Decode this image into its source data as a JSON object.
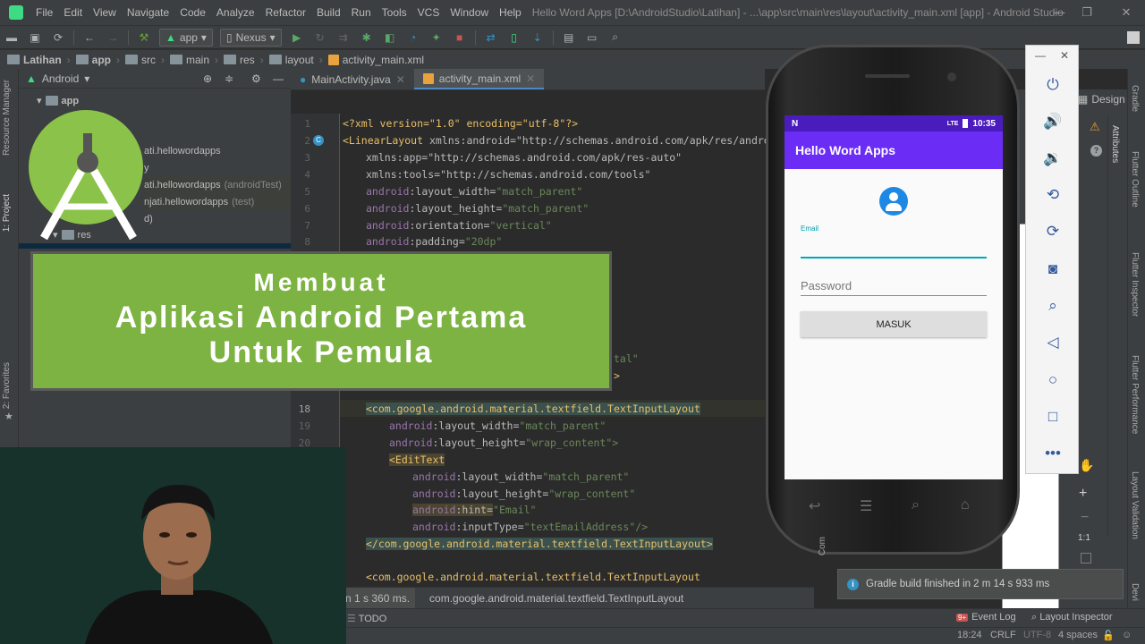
{
  "menu": {
    "items": [
      "File",
      "Edit",
      "View",
      "Navigate",
      "Code",
      "Analyze",
      "Refactor",
      "Build",
      "Run",
      "Tools",
      "VCS",
      "Window",
      "Help"
    ],
    "window_title": "Hello Word Apps [D:\\AndroidStudio\\Latihan] - ...\\app\\src\\main\\res\\layout\\activity_main.xml [app] - Android Studio"
  },
  "toolbar": {
    "run_config": "app",
    "device": "Nexus"
  },
  "breadcrumb": [
    "Latihan",
    "app",
    "src",
    "main",
    "res",
    "layout",
    "activity_main.xml"
  ],
  "left_stripe": {
    "resource_manager": "Resource Manager",
    "project": "1: Project",
    "favorites": "2: Favorites"
  },
  "project_panel": {
    "view_mode": "Android",
    "root": "app",
    "rows": [
      {
        "label": "ati.hellowordapps",
        "suffix": ""
      },
      {
        "label": "y",
        "suffix": ""
      },
      {
        "label": "ati.hellowordapps",
        "suffix": "(androidTest)"
      },
      {
        "label": "njati.hellowordapps",
        "suffix": "(test)"
      },
      {
        "label": "d)",
        "suffix": ""
      },
      {
        "label": "res",
        "suffix": ""
      }
    ]
  },
  "editor_tabs": [
    {
      "label": "MainActivity.java"
    },
    {
      "label": "activity_main.xml"
    }
  ],
  "code": {
    "l1": "<?xml version=\"1.0\" encoding=\"utf-8\"?>",
    "l2_tag": "<LinearLayout ",
    "l2_attr": "xmlns:android=\"http://schemas.android.com/apk/res/android\"",
    "l3": "xmlns:app=\"http://schemas.android.com/apk/res-auto\"",
    "l4": "xmlns:tools=\"http://schemas.android.com/tools\"",
    "l5_a": "android",
    "l5_b": ":layout_width=",
    "l5_c": "\"match_parent\"",
    "l6_b": ":layout_height=",
    "l6_c": "\"match_parent\"",
    "l7_b": ":orientation=",
    "l7_c": "\"vertical\"",
    "l8_b": ":padding=",
    "l8_c": "\"20dp\"",
    "l16_frag": "tal\"",
    "l17_frag": ">",
    "l18": "<com.google.android.material.textfield.TextInputLayout",
    "l19_c": "\"match_parent\"",
    "l20_c": "\"wrap_content\">",
    "l21": "<EditText",
    "l22_c": "\"match_parent\"",
    "l23_c": "\"wrap_content\"",
    "l24_b": ":hint=",
    "l24_c": "\"Email\"",
    "l25_b": ":inputType=",
    "l25_c": "\"textEmailAddress\"/>",
    "l26": "</com.google.android.material.textfield.TextInputLayout>",
    "l28": "<com.google.android.material.textfield.TextInputLayout"
  },
  "line_numbers": [
    "1",
    "2",
    "3",
    "4",
    "5",
    "6",
    "7",
    "8",
    "18",
    "19",
    "20"
  ],
  "editor_footer": {
    "left_frag": "n 1 s 360 ms.",
    "path": "com.google.android.material.textfield.TextInputLayout"
  },
  "bottom_tools": {
    "todo": "TODO",
    "event_log": "Event Log",
    "event_count": "9+",
    "layout_inspector": "Layout Inspector"
  },
  "statusbar": {
    "position": "18:24",
    "line_sep": "CRLF",
    "encoding": "UTF-8",
    "indent": "4 spaces"
  },
  "notification": "Gradle build finished in 2 m 14 s 933 ms",
  "design_tab": "Design",
  "right_stripe": {
    "gradle": "Gradle",
    "flutter_outline": "Flutter Outline",
    "flutter_inspector": "Flutter Inspector",
    "flutter_performance": "Flutter Performance",
    "layout_validation": "Layout Validation",
    "attributes": "Attributes",
    "device": "Devi"
  },
  "zoom_label": "1:1",
  "phone": {
    "status_time": "10:35",
    "status_left": "N",
    "status_lte": "LTE",
    "app_title": "Hello Word Apps",
    "email_label": "Email",
    "password_placeholder": "Password",
    "button_label": "MASUK"
  },
  "banner": {
    "line1": "Membuat",
    "line2": "Aplikasi Android Pertama",
    "line3": "Untuk Pemula"
  },
  "colors": {
    "app_bar": "#6b2cf5",
    "status_bar": "#4a1cbe",
    "banner": "#7cb342",
    "accent": "#00a8b8"
  }
}
